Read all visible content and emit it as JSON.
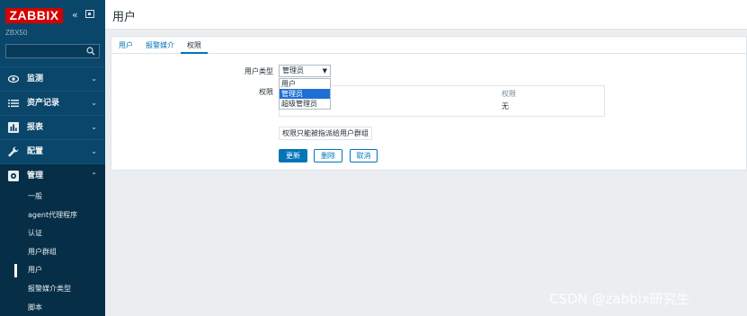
{
  "brand": {
    "logo_text": "ZABBIX",
    "collapse_glyph": "«",
    "server_name": "ZBX50"
  },
  "search": {
    "placeholder": ""
  },
  "menu": [
    {
      "label": "监测",
      "icon": "eye-icon",
      "chevron": "⌄"
    },
    {
      "label": "资产记录",
      "icon": "list-icon",
      "chevron": "⌄"
    },
    {
      "label": "报表",
      "icon": "bar-chart-icon",
      "chevron": "⌄"
    },
    {
      "label": "配置",
      "icon": "wrench-icon",
      "chevron": "⌄"
    },
    {
      "label": "管理",
      "icon": "gear-icon",
      "chevron": "⌃"
    }
  ],
  "submenu": [
    "一般",
    "agent代理程序",
    "认证",
    "用户群组",
    "用户",
    "报警媒介类型",
    "脚本"
  ],
  "page": {
    "title": "用户"
  },
  "tabs": [
    "用户",
    "报警媒介",
    "权限"
  ],
  "form": {
    "user_type_label": "用户类型",
    "user_type_value": "管理员",
    "user_type_options": [
      "用户",
      "管理员",
      "超级管理员"
    ],
    "permissions_label": "权限",
    "perm_column_header": "权限",
    "perm_value": "无",
    "note": "权限只能被指派给用户群组"
  },
  "buttons": {
    "update": "更新",
    "delete": "删除",
    "cancel": "取消"
  },
  "watermark": "CSDN @zabbix研究生",
  "colors": {
    "sidebar": "#0a466a",
    "brand_red": "#d40000",
    "primary": "#0275b8",
    "selected_option": "#1e6fd4"
  }
}
